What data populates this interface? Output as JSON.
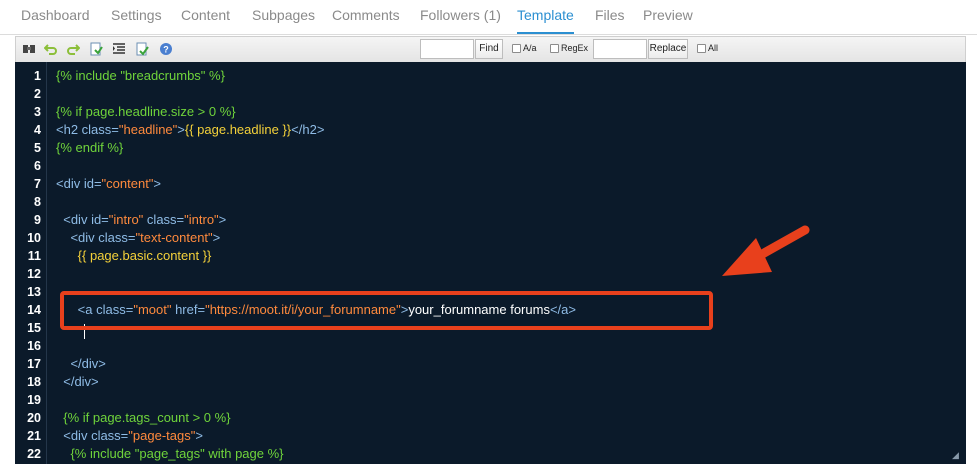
{
  "tabs": [
    {
      "label": "Dashboard"
    },
    {
      "label": "Settings"
    },
    {
      "label": "Content"
    },
    {
      "label": "Subpages"
    },
    {
      "label": "Comments"
    },
    {
      "label": "Followers (1)"
    },
    {
      "label": "Template",
      "active": true
    },
    {
      "label": "Files"
    },
    {
      "label": "Preview"
    }
  ],
  "toolbar": {
    "find_value": "",
    "find_button": "Find",
    "aa_label": "A/a",
    "regex_label": "RegEx",
    "replace_value": "",
    "replace_button": "Replace",
    "all_label": "All",
    "icons": [
      "search-icon",
      "undo-icon",
      "redo-icon",
      "format-icon",
      "indent-icon",
      "reformat-icon",
      "help-icon"
    ]
  },
  "editor": {
    "lines": [
      {
        "n": "1",
        "tokens": [
          {
            "c": "tpl",
            "t": "{% include \"breadcrumbs\" %}"
          }
        ]
      },
      {
        "n": "2",
        "tokens": []
      },
      {
        "n": "3",
        "tokens": [
          {
            "c": "tpl",
            "t": "{% if page.headline.size > 0 %}"
          }
        ]
      },
      {
        "n": "4",
        "tokens": [
          {
            "c": "tag",
            "t": "<h2 "
          },
          {
            "c": "attr",
            "t": "class="
          },
          {
            "c": "str",
            "t": "\"headline\""
          },
          {
            "c": "tag",
            "t": ">"
          },
          {
            "c": "var",
            "t": "{{ page.headline }}"
          },
          {
            "c": "tag",
            "t": "</h2>"
          }
        ]
      },
      {
        "n": "5",
        "tokens": [
          {
            "c": "tpl",
            "t": "{% endif %}"
          }
        ]
      },
      {
        "n": "6",
        "tokens": []
      },
      {
        "n": "7",
        "tokens": [
          {
            "c": "tag",
            "t": "<div "
          },
          {
            "c": "attr",
            "t": "id="
          },
          {
            "c": "str",
            "t": "\"content\""
          },
          {
            "c": "tag",
            "t": ">"
          }
        ]
      },
      {
        "n": "8",
        "tokens": []
      },
      {
        "n": "9",
        "tokens": [
          {
            "c": "plain",
            "t": "  "
          },
          {
            "c": "tag",
            "t": "<div "
          },
          {
            "c": "attr",
            "t": "id="
          },
          {
            "c": "str",
            "t": "\"intro\""
          },
          {
            "c": "attr",
            "t": " class="
          },
          {
            "c": "str",
            "t": "\"intro\""
          },
          {
            "c": "tag",
            "t": ">"
          }
        ]
      },
      {
        "n": "10",
        "tokens": [
          {
            "c": "plain",
            "t": "    "
          },
          {
            "c": "tag",
            "t": "<div "
          },
          {
            "c": "attr",
            "t": "class="
          },
          {
            "c": "str",
            "t": "\"text-content\""
          },
          {
            "c": "tag",
            "t": ">"
          }
        ]
      },
      {
        "n": "11",
        "tokens": [
          {
            "c": "plain",
            "t": "      "
          },
          {
            "c": "var",
            "t": "{{ page.basic.content }}"
          }
        ]
      },
      {
        "n": "12",
        "tokens": []
      },
      {
        "n": "13",
        "tokens": []
      },
      {
        "n": "14",
        "tokens": [
          {
            "c": "plain",
            "t": "      "
          },
          {
            "c": "tag",
            "t": "<a "
          },
          {
            "c": "attr",
            "t": "class="
          },
          {
            "c": "str",
            "t": "\"moot\""
          },
          {
            "c": "attr",
            "t": " href="
          },
          {
            "c": "str",
            "t": "\"https://moot.it/i/your_forumname\""
          },
          {
            "c": "tag",
            "t": ">"
          },
          {
            "c": "text",
            "t": "your_forumname forums"
          },
          {
            "c": "tag",
            "t": "</a>"
          }
        ]
      },
      {
        "n": "15",
        "tokens": []
      },
      {
        "n": "16",
        "tokens": []
      },
      {
        "n": "17",
        "tokens": [
          {
            "c": "plain",
            "t": "    "
          },
          {
            "c": "tag",
            "t": "</div>"
          }
        ]
      },
      {
        "n": "18",
        "tokens": [
          {
            "c": "plain",
            "t": "  "
          },
          {
            "c": "tag",
            "t": "</div>"
          }
        ]
      },
      {
        "n": "19",
        "tokens": []
      },
      {
        "n": "20",
        "tokens": [
          {
            "c": "plain",
            "t": "  "
          },
          {
            "c": "tpl",
            "t": "{% if page.tags_count > 0 %}"
          }
        ]
      },
      {
        "n": "21",
        "tokens": [
          {
            "c": "plain",
            "t": "  "
          },
          {
            "c": "tag",
            "t": "<div "
          },
          {
            "c": "attr",
            "t": "class="
          },
          {
            "c": "str",
            "t": "\"page-tags\""
          },
          {
            "c": "tag",
            "t": ">"
          }
        ]
      },
      {
        "n": "22",
        "tokens": [
          {
            "c": "plain",
            "t": "    "
          },
          {
            "c": "tpl",
            "t": "{% include \"page_tags\" with page %}"
          }
        ]
      }
    ]
  },
  "colors": {
    "accent": "#2b8fd1",
    "editor_bg": "#0b1a2a",
    "annotation": "#e8401c"
  }
}
